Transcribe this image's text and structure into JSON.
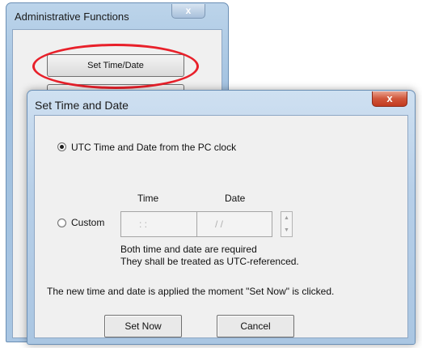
{
  "admin_window": {
    "title": "Administrative Functions",
    "close_glyph": "x",
    "set_time_button": "Set Time/Date",
    "highlight_color": "#e8202a"
  },
  "dialog": {
    "title": "Set Time and Date",
    "close_glyph": "x",
    "option_utc": {
      "label": "UTC Time and Date from the PC clock",
      "selected": true
    },
    "option_custom": {
      "label": "Custom",
      "selected": false
    },
    "time_header": "Time",
    "date_header": "Date",
    "time_field": ":   :",
    "date_field": "/   /",
    "note_line1": "Both time and date are required",
    "note_line2": "They shall be treated as UTC-referenced.",
    "apply_text": "The new time and date is applied the moment  \"Set Now\" is clicked.",
    "set_now_button": "Set Now",
    "cancel_button": "Cancel",
    "close_color": "#c23a1f"
  }
}
